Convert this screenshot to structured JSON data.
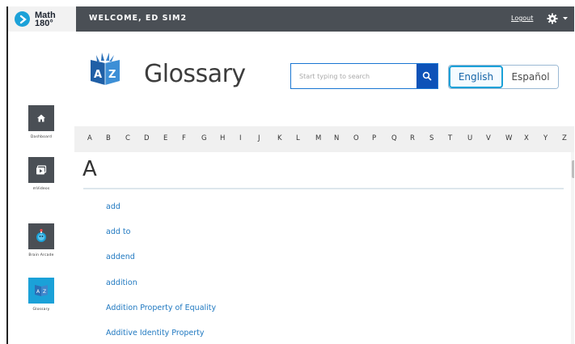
{
  "brand": {
    "logo_text_line1": "Math",
    "logo_text_line2": "180°"
  },
  "topbar": {
    "welcome": "WELCOME, ED SIM2",
    "logout": "Logout"
  },
  "sidebar": {
    "items": [
      {
        "label": "Dashboard",
        "icon": "home-icon"
      },
      {
        "label": "mVideos",
        "icon": "video-icon"
      },
      {
        "label": "Brain Arcade",
        "icon": "brain-arcade-icon"
      },
      {
        "label": "Glossary",
        "icon": "glossary-icon",
        "active": true
      }
    ]
  },
  "header": {
    "title": "Glossary"
  },
  "search": {
    "placeholder": "Start typing to search"
  },
  "language": {
    "english": "English",
    "spanish": "Español",
    "selected": "English"
  },
  "alphabet": [
    "A",
    "B",
    "C",
    "D",
    "E",
    "F",
    "G",
    "H",
    "I",
    "J",
    "K",
    "L",
    "M",
    "N",
    "O",
    "P",
    "Q",
    "R",
    "S",
    "T",
    "U",
    "V",
    "W",
    "X",
    "Y",
    "Z"
  ],
  "section": {
    "letter": "A",
    "terms": [
      "add",
      "add to",
      "addend",
      "addition",
      "Addition Property of Equality",
      "Additive Identity Property"
    ]
  },
  "colors": {
    "topbar": "#4a4f55",
    "accent": "#1ba1d8",
    "link": "#1f78c0",
    "search_button": "#0d52b8"
  }
}
